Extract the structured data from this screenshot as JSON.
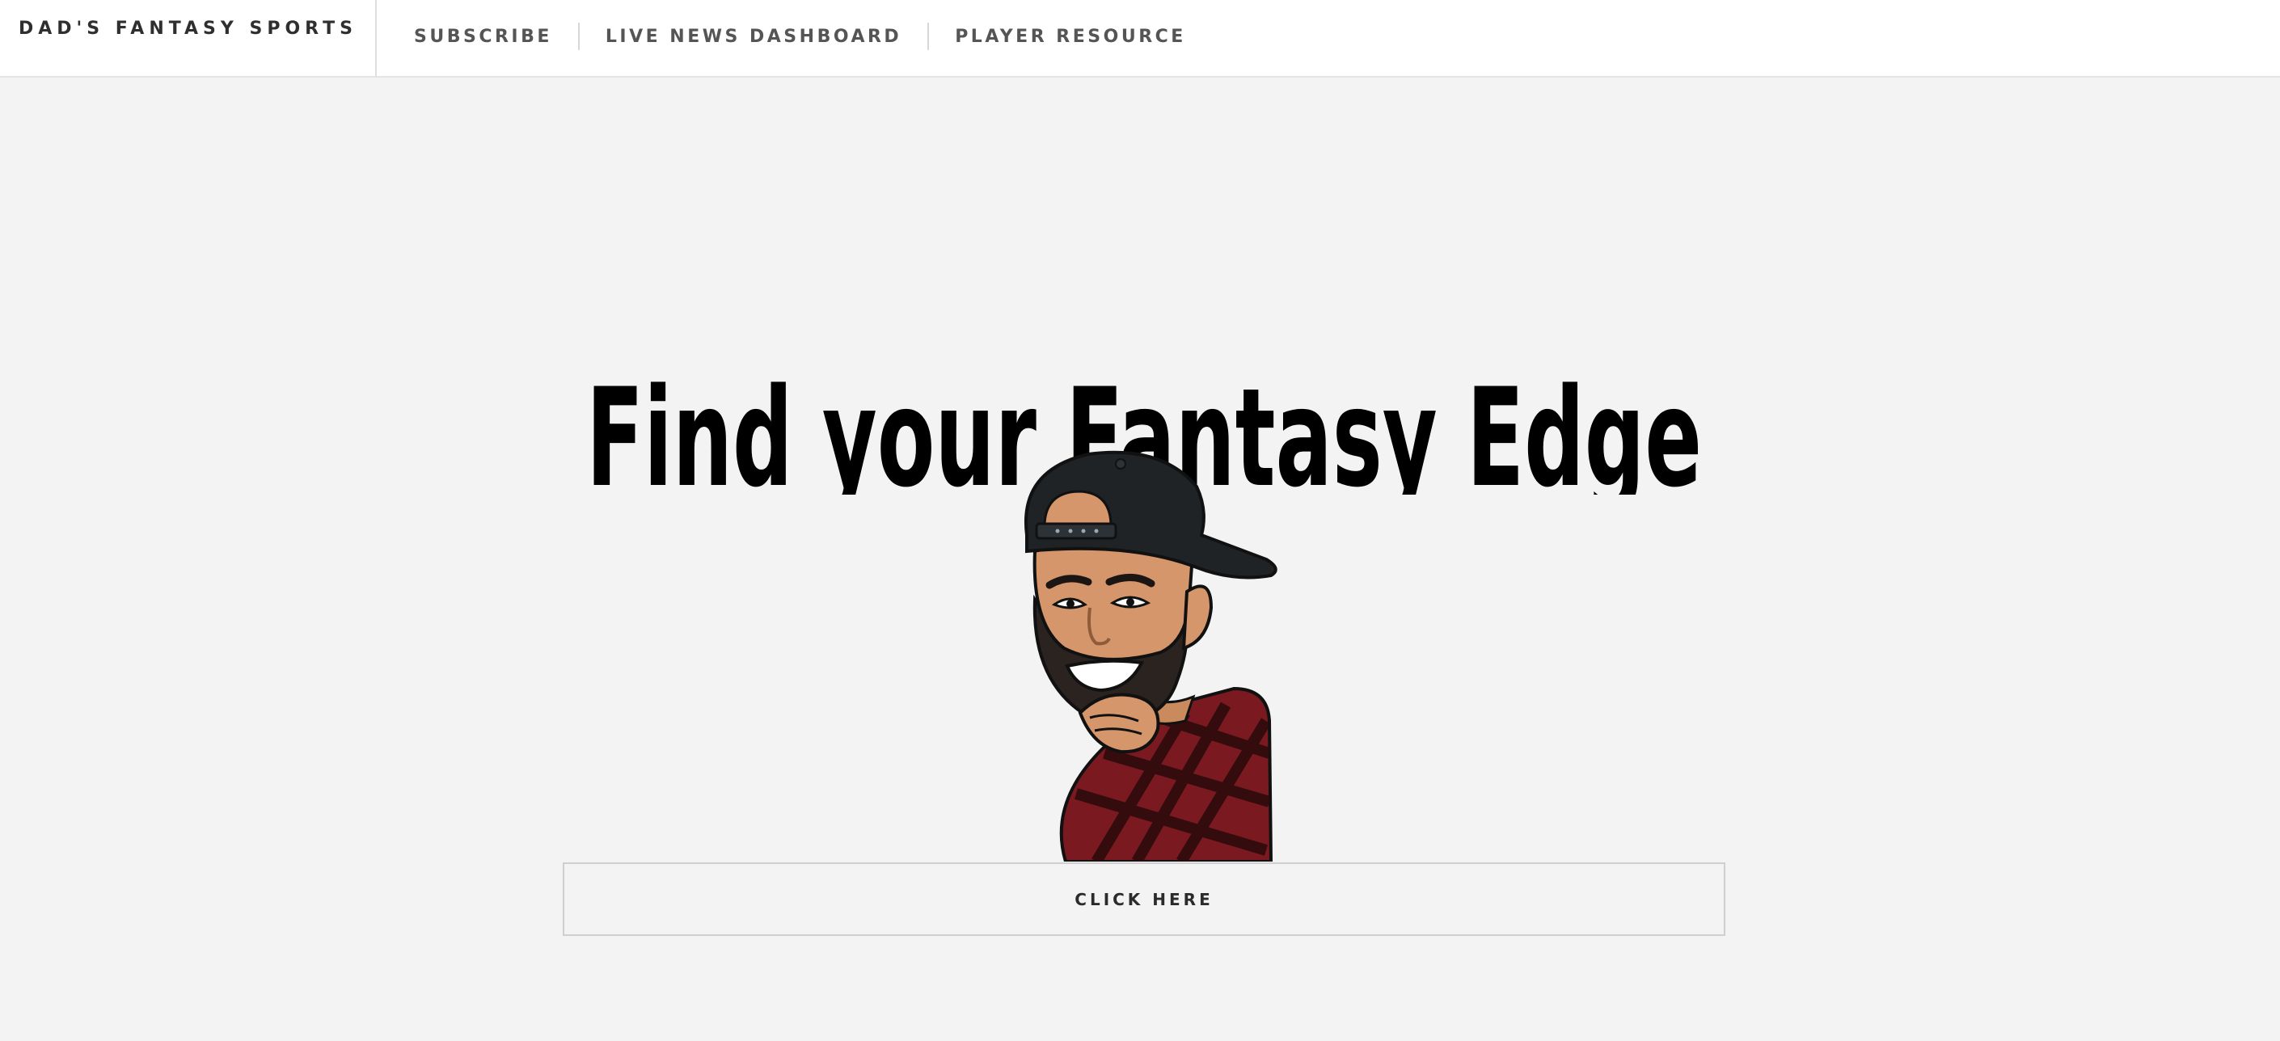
{
  "header": {
    "brand": "DAD'S FANTASY SPORTS",
    "nav": [
      {
        "label": "SUBSCRIBE"
      },
      {
        "label": "LIVE NEWS DASHBOARD"
      },
      {
        "label": "PLAYER RESOURCE"
      }
    ]
  },
  "hero": {
    "title": "Find your Fantasy Edge",
    "mascot_icon": "cartoon-dad-mascot",
    "cta_label": "CLICK HERE"
  },
  "colors": {
    "background": "#f3f3f3",
    "header_bg": "#ffffff",
    "title": "#000000",
    "cap": "#1f2326",
    "skin": "#d4966a",
    "beard": "#2a2320",
    "shirt_red": "#7a1a20",
    "shirt_dark": "#2a0a0c"
  }
}
